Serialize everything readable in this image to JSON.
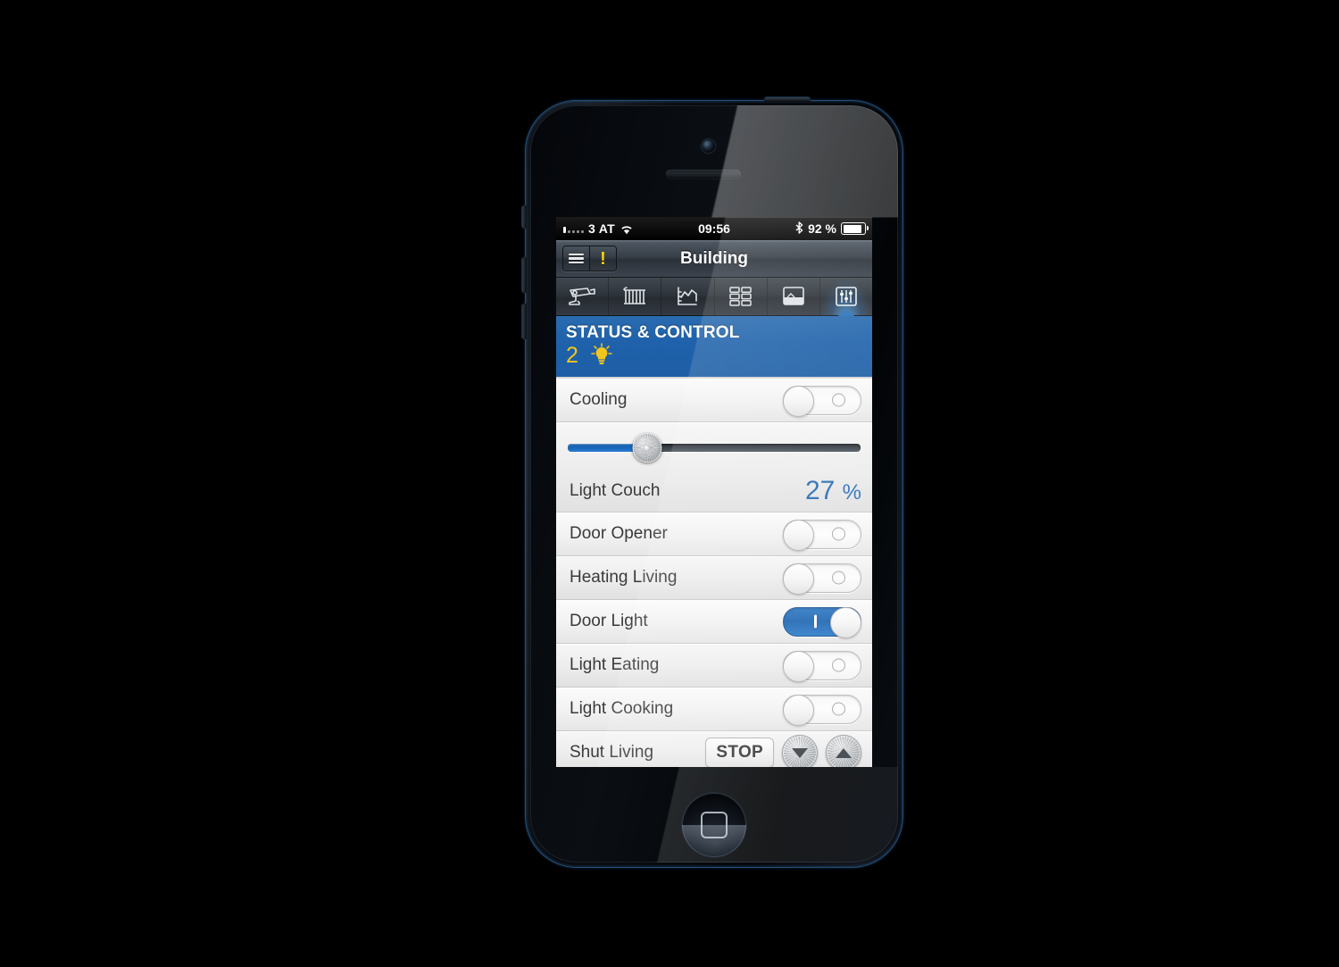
{
  "status_bar": {
    "signal_icon": "signal-dots",
    "carrier": "3 AT",
    "wifi_icon": "wifi-icon",
    "time": "09:56",
    "bluetooth_icon": "bluetooth-icon",
    "battery_text": "92 %",
    "battery_icon": "battery-icon"
  },
  "navbar": {
    "menu_icon": "hamburger-menu-icon",
    "alert_icon": "exclamation-icon",
    "alert_label": "!",
    "title": "Building"
  },
  "tabs": [
    {
      "name": "camera",
      "icon": "security-camera-icon",
      "active": false
    },
    {
      "name": "heating",
      "icon": "radiator-icon",
      "active": false
    },
    {
      "name": "trend",
      "icon": "line-chart-icon",
      "active": false
    },
    {
      "name": "grid",
      "icon": "grid-buttons-icon",
      "active": false
    },
    {
      "name": "floorplan",
      "icon": "picture-icon",
      "active": false
    },
    {
      "name": "status-control",
      "icon": "sliders-icon",
      "active": true
    }
  ],
  "section": {
    "title": "STATUS & CONTROL",
    "count": "2",
    "count_icon": "lightbulb-icon",
    "accent_color": "#1f62ab",
    "count_color": "#f2c61d"
  },
  "rows": [
    {
      "label": "Cooling",
      "control": "toggle",
      "state": "off"
    },
    {
      "label": "Light Couch",
      "control": "slider",
      "value": "27",
      "unit": "%",
      "percent": 27,
      "value_color": "#2a6db5"
    },
    {
      "label": "Door Opener",
      "control": "toggle",
      "state": "off"
    },
    {
      "label": "Heating Living",
      "control": "toggle",
      "state": "off"
    },
    {
      "label": "Door Light",
      "control": "toggle",
      "state": "on"
    },
    {
      "label": "Light Eating",
      "control": "toggle",
      "state": "off"
    },
    {
      "label": "Light Cooking",
      "control": "toggle",
      "state": "off"
    },
    {
      "label": "Shut Living",
      "control": "shutter",
      "stop_label": "STOP",
      "down_icon": "arrow-down-icon",
      "up_icon": "arrow-up-icon"
    }
  ],
  "device": {
    "home_button_icon": "home-button-icon",
    "camera_icon": "front-camera",
    "speaker_icon": "earpiece-speaker"
  }
}
